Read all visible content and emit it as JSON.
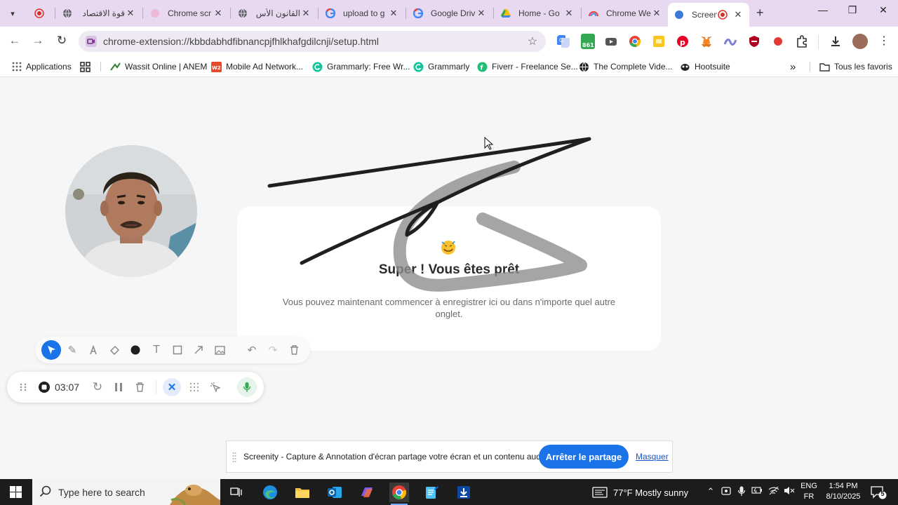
{
  "browser": {
    "tabs": [
      {
        "title": "",
        "favicon": "record-icon"
      },
      {
        "title": "قوة الاقتصاد",
        "favicon": "globe-icon"
      },
      {
        "title": "Chrome scr",
        "favicon": "screenity-icon"
      },
      {
        "title": "القانون الأس",
        "favicon": "globe-icon"
      },
      {
        "title": "upload to g",
        "favicon": "google-icon"
      },
      {
        "title": "Google Driv",
        "favicon": "google-icon"
      },
      {
        "title": "Home - Go",
        "favicon": "drive-icon"
      },
      {
        "title": "Chrome We",
        "favicon": "rainbow-icon"
      },
      {
        "title": "Screeni",
        "favicon": "globe-icon",
        "active": true
      }
    ],
    "close_glyph": "✕",
    "new_tab_glyph": "+",
    "window_controls": {
      "minimize": "—",
      "maximize": "❐",
      "close": "✕"
    },
    "url": "chrome-extension://kbbdabhdfibnancpjfhlkhafgdilcnji/setup.html",
    "extensions": [
      "translate-icon",
      "counter-icon",
      "youtube-icon",
      "chrome-icon",
      "sticky-icon",
      "pinterest-icon",
      "metamask-icon",
      "wave-icon",
      "shield-icon",
      "record-icon",
      "puzzle-icon"
    ],
    "extension_badge": "861",
    "bookmarks": [
      {
        "label": "Applications",
        "icon": "apps-grid-icon"
      },
      {
        "label": "",
        "icon": "grid-icon"
      },
      {
        "label": "Wassit Online | ANEM",
        "icon": "wassit-icon"
      },
      {
        "label": "Mobile Ad Network...",
        "icon": "w2-icon"
      },
      {
        "label": "Grammarly: Free Wr...",
        "icon": "grammarly-icon"
      },
      {
        "label": "Grammarly",
        "icon": "grammarly-icon"
      },
      {
        "label": "Fiverr - Freelance Se...",
        "icon": "fiverr-icon"
      },
      {
        "label": "The Complete Vide...",
        "icon": "globe-icon"
      },
      {
        "label": "Hootsuite",
        "icon": "hootsuite-icon"
      }
    ],
    "bookmarks_more": "»",
    "all_bookmarks": "Tous les favoris"
  },
  "setup": {
    "title": "Super ! Vous êtes prêt",
    "message": "Vous pouvez maintenant commencer à enregistrer ici ou dans n'importe quel autre onglet."
  },
  "recorder": {
    "timer": "03:07",
    "draw_tools": [
      "select",
      "pen",
      "highlighter",
      "eraser",
      "color",
      "text",
      "rectangle",
      "arrow",
      "image",
      "undo",
      "redo",
      "delete"
    ],
    "accent_color": "#1a73e8",
    "mic_color": "#34a853"
  },
  "share_banner": {
    "text": "Screenity - Capture & Annotation d'écran partage votre écran et un contenu audio.",
    "stop_label": "Arrêter le partage",
    "hide_label": "Masquer"
  },
  "taskbar": {
    "search_placeholder": "Type here to search",
    "weather": "77°F  Mostly sunny",
    "lang_top": "ENG",
    "lang_bottom": "FR",
    "time": "1:54 PM",
    "date": "8/10/2025",
    "notification_count": "5"
  }
}
